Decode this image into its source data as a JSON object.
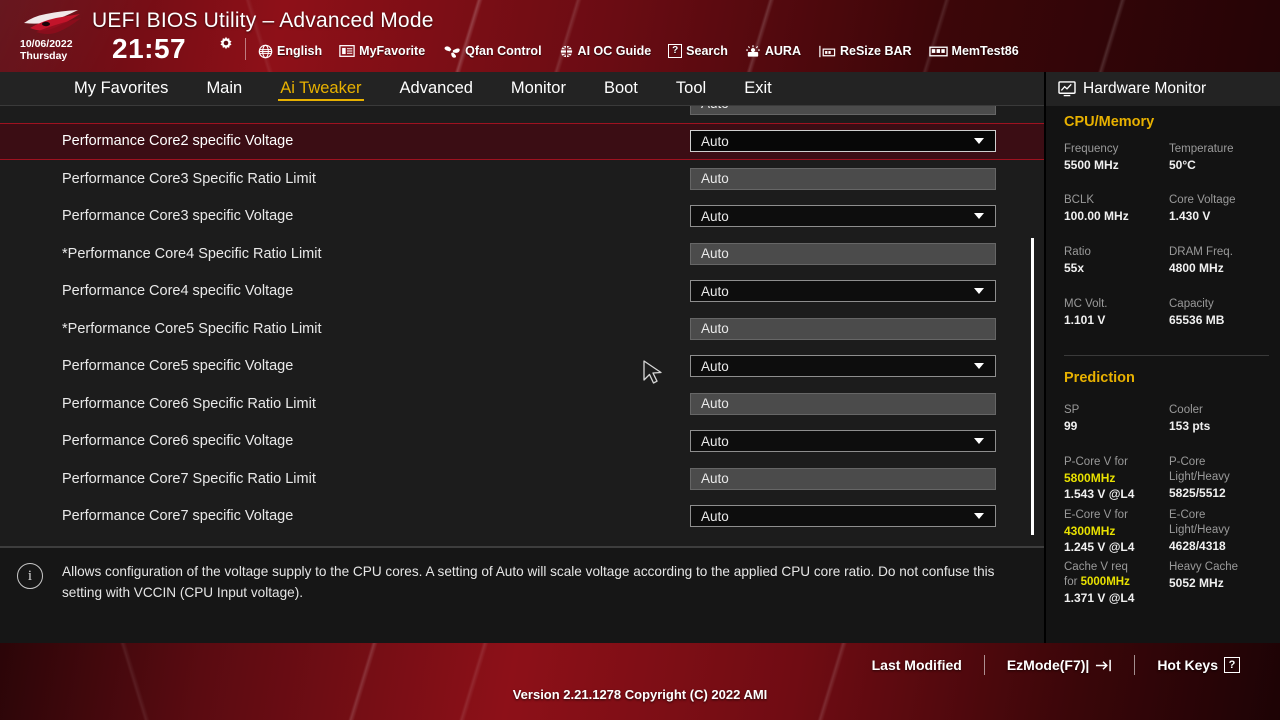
{
  "header": {
    "title": "UEFI BIOS Utility – Advanced Mode",
    "date": "10/06/2022",
    "weekday": "Thursday",
    "time": "21:57",
    "tools": [
      {
        "icon": "globe-icon",
        "label": "English"
      },
      {
        "icon": "myfavorite-icon",
        "label": "MyFavorite"
      },
      {
        "icon": "fan-icon",
        "label": "Qfan Control"
      },
      {
        "icon": "ai-oc-guide-icon",
        "label": "AI OC Guide"
      },
      {
        "icon": "search-icon",
        "label": "Search"
      },
      {
        "icon": "aura-icon",
        "label": "AURA"
      },
      {
        "icon": "resize-bar-icon",
        "label": "ReSize BAR"
      },
      {
        "icon": "memtest86-icon",
        "label": "MemTest86"
      }
    ]
  },
  "menu": {
    "items": [
      {
        "label": "My Favorites",
        "active": false
      },
      {
        "label": "Main",
        "active": false
      },
      {
        "label": "Ai Tweaker",
        "active": true
      },
      {
        "label": "Advanced",
        "active": false
      },
      {
        "label": "Monitor",
        "active": false
      },
      {
        "label": "Boot",
        "active": false
      },
      {
        "label": "Tool",
        "active": false
      },
      {
        "label": "Exit",
        "active": false
      }
    ]
  },
  "settings": {
    "rows": [
      {
        "label": "",
        "value": "Auto",
        "type": "plain",
        "selected": false,
        "clipped": true
      },
      {
        "label": "Performance Core2 specific Voltage",
        "value": "Auto",
        "type": "combo",
        "selected": true
      },
      {
        "label": "Performance Core3 Specific Ratio Limit",
        "value": "Auto",
        "type": "plain",
        "selected": false
      },
      {
        "label": "Performance Core3 specific Voltage",
        "value": "Auto",
        "type": "combo",
        "selected": false
      },
      {
        "label": "*Performance Core4 Specific Ratio Limit",
        "value": "Auto",
        "type": "plain",
        "selected": false
      },
      {
        "label": "Performance Core4 specific Voltage",
        "value": "Auto",
        "type": "combo",
        "selected": false
      },
      {
        "label": "*Performance Core5 Specific Ratio Limit",
        "value": "Auto",
        "type": "plain",
        "selected": false
      },
      {
        "label": "Performance Core5 specific Voltage",
        "value": "Auto",
        "type": "combo",
        "selected": false
      },
      {
        "label": "Performance Core6 Specific Ratio Limit",
        "value": "Auto",
        "type": "plain",
        "selected": false
      },
      {
        "label": "Performance Core6 specific Voltage",
        "value": "Auto",
        "type": "combo",
        "selected": false
      },
      {
        "label": "Performance Core7 Specific Ratio Limit",
        "value": "Auto",
        "type": "plain",
        "selected": false
      },
      {
        "label": "Performance Core7 specific Voltage",
        "value": "Auto",
        "type": "combo",
        "selected": false
      }
    ]
  },
  "help": {
    "icon": "info-icon",
    "text": "Allows configuration of the voltage supply to the CPU cores. A setting of Auto will scale voltage according to the applied CPU core ratio.  Do not confuse this setting with VCCIN (CPU Input voltage)."
  },
  "hardware_monitor": {
    "panel_title": "Hardware Monitor",
    "panel_icon": "monitor-icon",
    "sections": [
      {
        "title": "CPU/Memory",
        "pairs": [
          {
            "key": "Frequency",
            "value": "5500 MHz"
          },
          {
            "key": "Temperature",
            "value": "50°C"
          },
          {
            "key": "BCLK",
            "value": "100.00 MHz"
          },
          {
            "key": "Core Voltage",
            "value": "1.430 V"
          },
          {
            "key": "Ratio",
            "value": "55x"
          },
          {
            "key": "DRAM Freq.",
            "value": "4800 MHz"
          },
          {
            "key": "MC Volt.",
            "value": "1.101 V"
          },
          {
            "key": "Capacity",
            "value": "65536 MB"
          }
        ]
      },
      {
        "title": "Prediction",
        "sp_key": "SP",
        "sp_value": "99",
        "cooler_key": "Cooler",
        "cooler_value": "153 pts",
        "pcore_v_key_a": "P-Core V for",
        "pcore_v_key_b": "5800MHz",
        "pcore_v_value": "1.543 V @L4",
        "pcore_lh_key_a": "P-Core",
        "pcore_lh_key_b": "Light/Heavy",
        "pcore_lh_value": "5825/5512",
        "ecore_v_key_a": "E-Core V for",
        "ecore_v_key_b": "4300MHz",
        "ecore_v_value": "1.245 V @L4",
        "ecore_lh_key_a": "E-Core",
        "ecore_lh_key_b": "Light/Heavy",
        "ecore_lh_value": "4628/4318",
        "cache_key_a": "Cache V req",
        "cache_key_b": "for",
        "cache_key_c": "5000MHz",
        "cache_value": "1.371 V @L4",
        "heavy_cache_key": "Heavy Cache",
        "heavy_cache_value": "5052 MHz"
      }
    ]
  },
  "footer": {
    "last_modified": "Last Modified",
    "ezmode": "EzMode(F7)|",
    "hotkeys": "Hot Keys",
    "hotkeys_badge": "?",
    "version": "Version 2.21.1278 Copyright (C) 2022 AMI"
  },
  "colors": {
    "accent_yellow": "#e8b100",
    "highlight_yellow": "#e8e100",
    "selected_row_bg": "#3b0d14",
    "selected_row_border": "#9e1220",
    "panel_bg": "#1c1c1c"
  }
}
